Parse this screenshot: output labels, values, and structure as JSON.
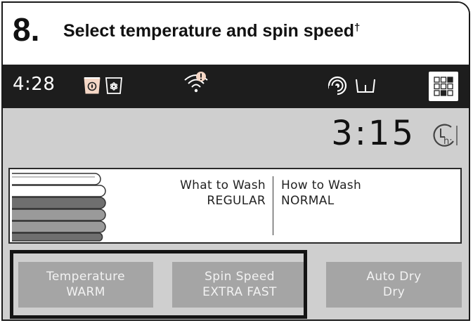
{
  "step": {
    "number": "8.",
    "title": "Select temperature and spin speed",
    "footnote_mark": "†"
  },
  "status_bar": {
    "time": "4:28",
    "icons": [
      "detergent-icon",
      "softener-icon",
      "wifi-alert-icon",
      "remote-control-icon",
      "basket-icon",
      "menu-grid-icon"
    ]
  },
  "display": {
    "remaining_time": "3:15",
    "timer_icon": "delay-timer-icon"
  },
  "cycle": {
    "what_label": "What to Wash",
    "what_value": "REGULAR",
    "how_label": "How to Wash",
    "how_value": "NORMAL"
  },
  "buttons": [
    {
      "label": "Temperature",
      "value": "WARM"
    },
    {
      "label": "Spin Speed",
      "value": "EXTRA FAST"
    },
    {
      "label": "Auto Dry",
      "value": "Dry"
    }
  ],
  "colors": {
    "status_bar": "#1d1d1d",
    "screen_bg": "#cfcfcf",
    "button_bg": "#a5a5a5",
    "highlight": "#141414",
    "icon_tint": "#f5d7c6"
  }
}
